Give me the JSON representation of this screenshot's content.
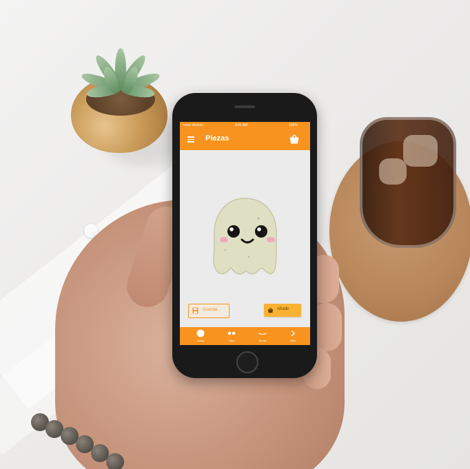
{
  "colors": {
    "accent": "#f7931e",
    "add_button": "#f9b233",
    "screen_background": "#ebebeb"
  },
  "status_bar": {
    "carrier": "••ooo Verizon",
    "time": "9:41 AM",
    "battery": "100%"
  },
  "app_bar": {
    "title": "Piezas",
    "left_icon": "menu-icon",
    "right_icon": "basket-icon"
  },
  "content": {
    "image": "ghost-cookie"
  },
  "actions": {
    "save_label": "Guardar",
    "add_label": "Añadir"
  },
  "bottom_nav": {
    "items": [
      {
        "label": "Caras",
        "icon": "circle-icon"
      },
      {
        "label": "Ojos",
        "icon": "eyes-icon"
      },
      {
        "label": "Bocas",
        "icon": "mouth-icon"
      },
      {
        "label": "Más",
        "icon": "chevron-right-icon"
      }
    ]
  }
}
